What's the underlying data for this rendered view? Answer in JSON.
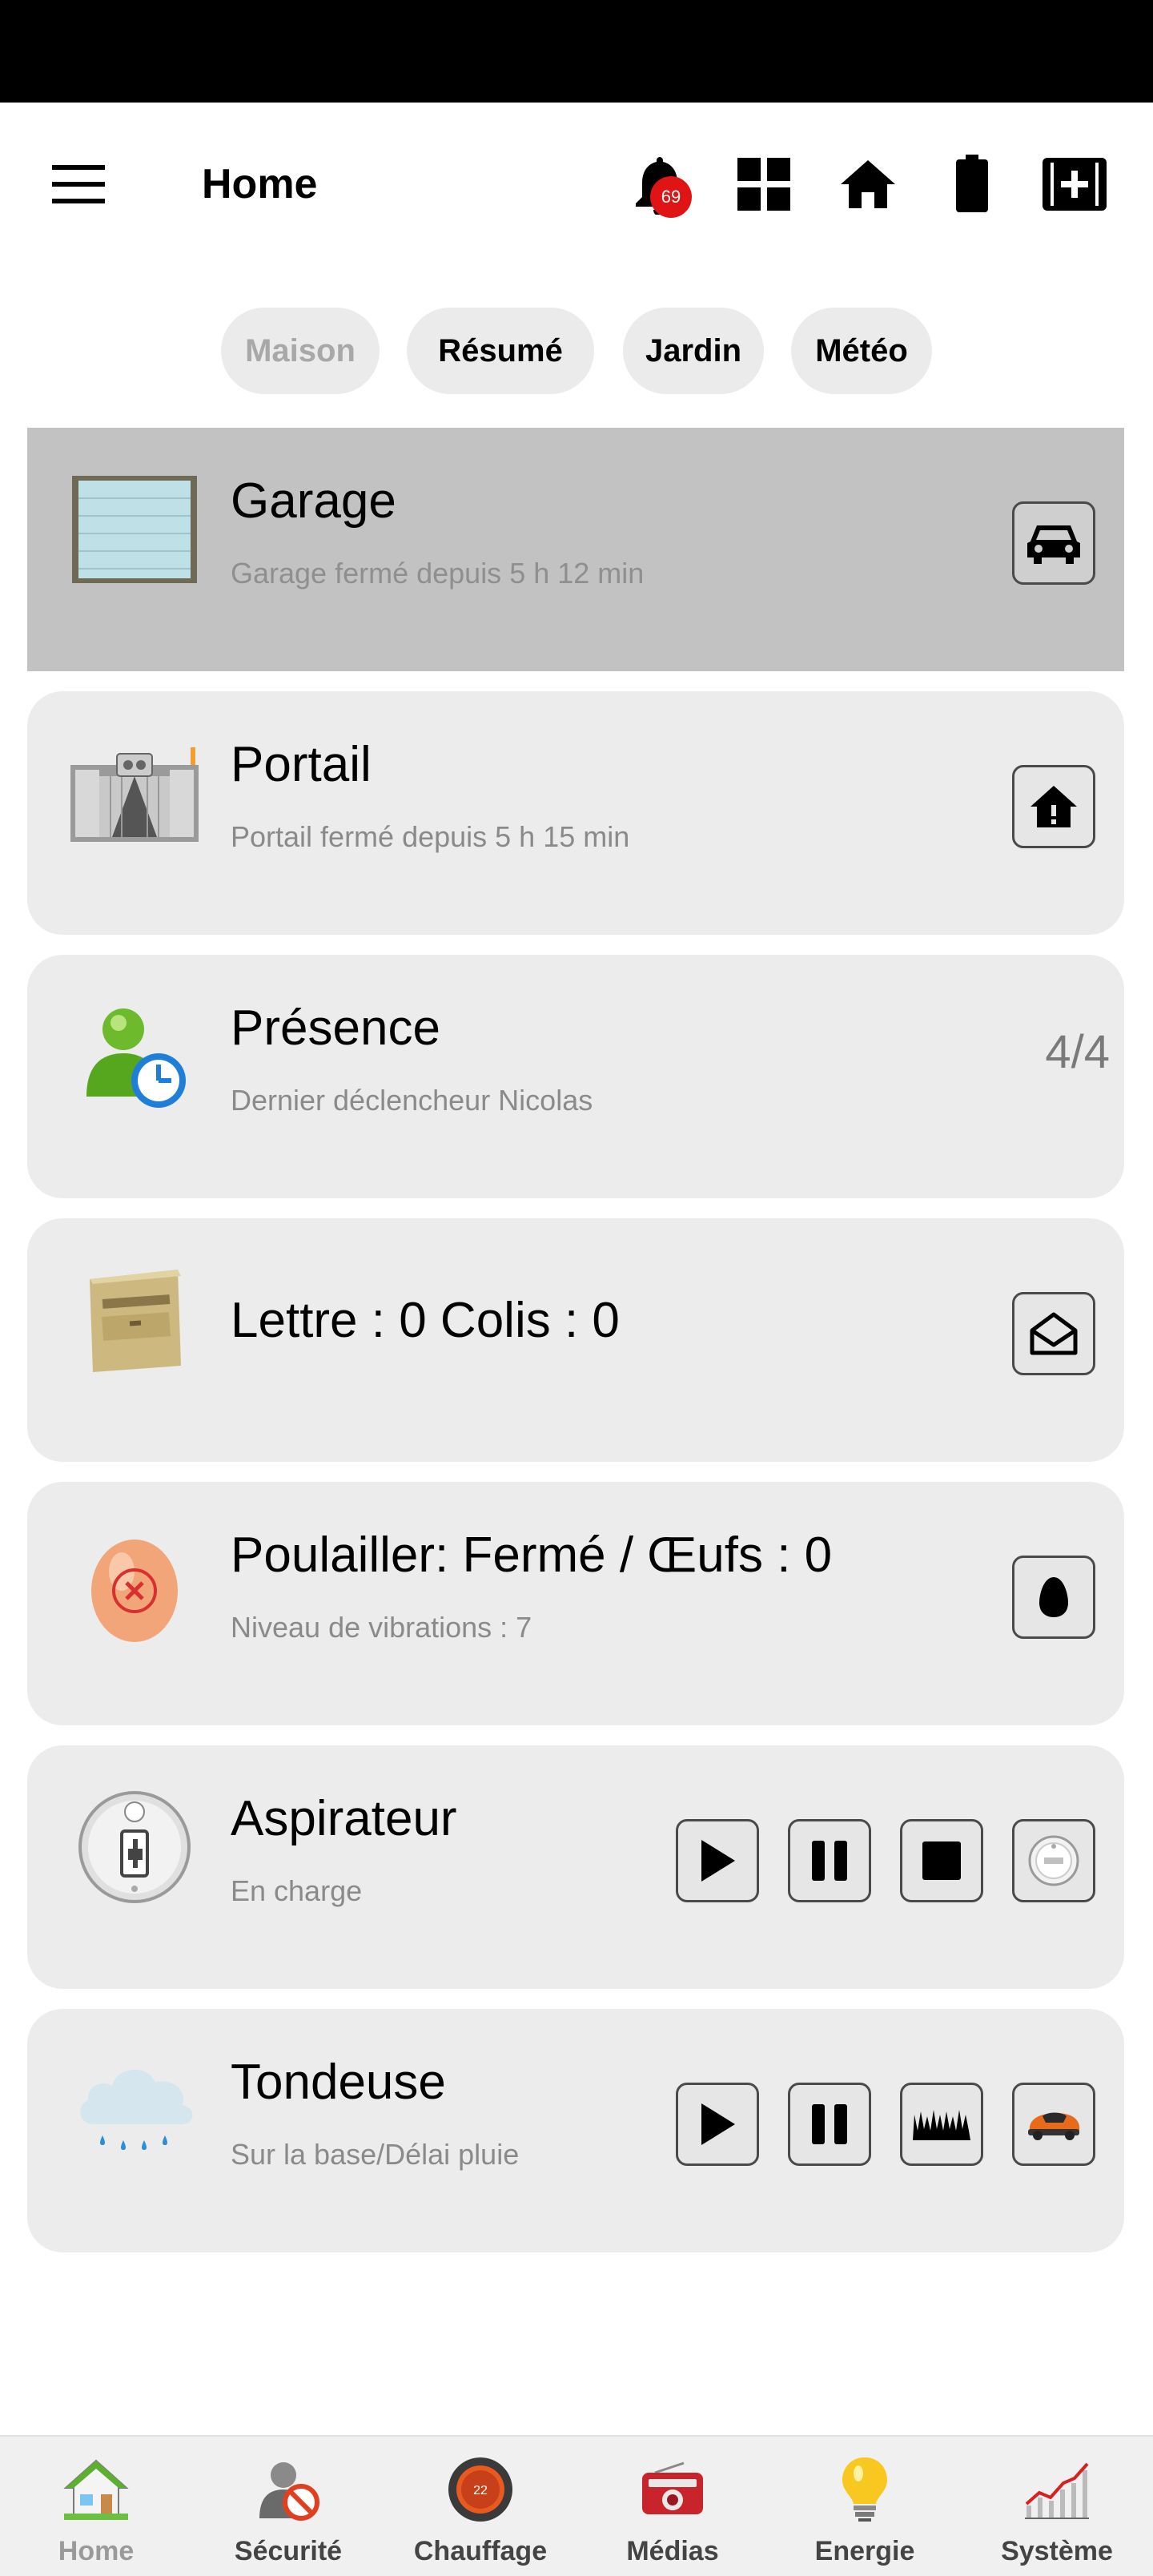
{
  "header": {
    "title": "Home",
    "notification_count": "69",
    "icons": [
      "menu-icon",
      "bell-icon",
      "grid-icon",
      "home-icon",
      "battery-icon",
      "medical-kit-icon"
    ]
  },
  "tabs": [
    {
      "label": "Maison",
      "active": true
    },
    {
      "label": "Résumé",
      "active": false
    },
    {
      "label": "Jardin",
      "active": false
    },
    {
      "label": "Météo",
      "active": false
    }
  ],
  "cards": {
    "garage": {
      "title": "Garage",
      "subtitle": "Garage fermé depuis 5 h 12 min",
      "icon": "garage-door-icon",
      "action_icon": "car-icon"
    },
    "portail": {
      "title": "Portail",
      "subtitle": "Portail fermé depuis 5 h 15 min",
      "icon": "gate-icon",
      "action_icon": "house-alert-icon"
    },
    "presence": {
      "title": "Présence",
      "subtitle": "Dernier déclencheur Nicolas",
      "icon": "person-clock-icon",
      "count": "4/4"
    },
    "mail": {
      "title": "Lettre :  0   Colis : 0",
      "icon": "mailbox-icon",
      "action_icon": "envelope-open-icon"
    },
    "poulailler": {
      "title": "Poulailler: Fermé / Œufs : 0",
      "subtitle": "Niveau de vibrations : 7",
      "icon": "egg-icon",
      "action_icon": "egg-icon"
    },
    "aspirateur": {
      "title": "Aspirateur",
      "subtitle": "En charge",
      "icon": "vacuum-charging-icon",
      "actions": [
        "play-icon",
        "pause-icon",
        "stop-icon",
        "robot-vacuum-icon"
      ]
    },
    "tondeuse": {
      "title": "Tondeuse",
      "subtitle": "Sur la base/Délai pluie",
      "icon": "rain-cloud-icon",
      "actions": [
        "play-icon",
        "pause-icon",
        "grass-icon",
        "robot-mower-icon"
      ]
    }
  },
  "bottom_nav": [
    {
      "label": "Home",
      "icon": "house-icon",
      "active": true
    },
    {
      "label": "Sécurité",
      "icon": "security-icon",
      "active": false
    },
    {
      "label": "Chauffage",
      "icon": "thermostat-icon",
      "thermostat_value": "22",
      "active": false
    },
    {
      "label": "Médias",
      "icon": "radio-icon",
      "active": false
    },
    {
      "label": "Energie",
      "icon": "lightbulb-icon",
      "active": false
    },
    {
      "label": "Système",
      "icon": "chart-icon",
      "active": false
    }
  ],
  "colors": {
    "badge": "#e01414",
    "card_bg": "#ececec",
    "card_selected_bg": "#c2c2c2",
    "tab_bg": "#ebebeb",
    "inactive_tab_text": "#a8a8a8"
  }
}
